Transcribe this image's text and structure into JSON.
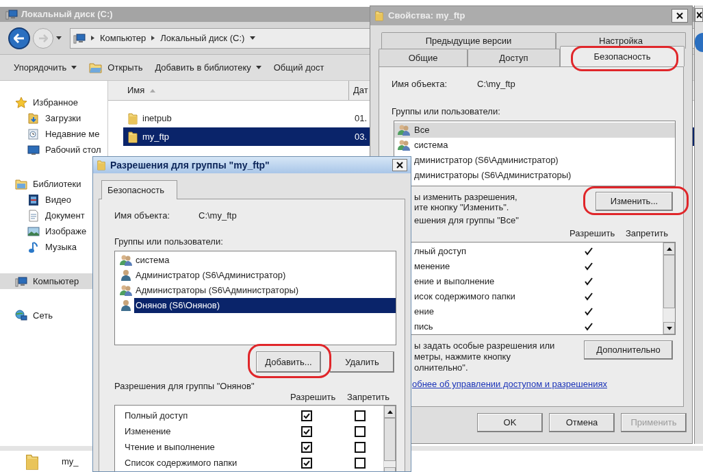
{
  "explorer": {
    "title": "Локальный диск (C:)",
    "breadcrumbs": [
      "Компьютер",
      "Локальный диск (C:)"
    ],
    "toolbar": [
      {
        "label": "Упорядочить",
        "kind": "menu"
      },
      {
        "label": "Открыть",
        "kind": "open"
      },
      {
        "label": "Добавить в библиотеку",
        "kind": "menu"
      },
      {
        "label": "Общий дост",
        "kind": "plain"
      }
    ],
    "sidebar": [
      {
        "label": "Избранное",
        "kind": "star",
        "selected": false,
        "children": [
          {
            "label": "Загрузки",
            "kind": "downloads",
            "selected": false
          },
          {
            "label": "Недавние ме",
            "kind": "recent",
            "selected": false
          },
          {
            "label": "Рабочий стол",
            "kind": "desktop",
            "selected": false
          }
        ]
      },
      {
        "label": "Библиотеки",
        "kind": "library",
        "selected": false,
        "children": [
          {
            "label": "Видео",
            "kind": "video",
            "selected": false
          },
          {
            "label": "Документ",
            "kind": "document",
            "selected": false
          },
          {
            "label": "Изображе",
            "kind": "image",
            "selected": false
          },
          {
            "label": "Музыка",
            "kind": "music",
            "selected": false
          }
        ]
      },
      {
        "label": "Компьютер",
        "kind": "computer",
        "selected": true
      },
      {
        "label": "Сеть",
        "kind": "network",
        "selected": false
      }
    ],
    "columns": [
      "Имя",
      "Дат"
    ],
    "files": [
      {
        "name": "inetpub",
        "date": "01.",
        "selected": false
      },
      {
        "name": "my_ftp",
        "date": "03.",
        "selected": true
      }
    ],
    "details": {
      "name": "my_"
    }
  },
  "properties": {
    "title": "Свойства: my_ftp",
    "tab_rows": [
      [
        {
          "label": "Предыдущие версии",
          "selected": false
        },
        {
          "label": "Настройка",
          "selected": false
        }
      ],
      [
        {
          "label": "Общие",
          "selected": false
        },
        {
          "label": "Доступ",
          "selected": false
        },
        {
          "label": "Безопасность",
          "selected": true
        }
      ]
    ],
    "object_label": "Имя объекта:",
    "object_value": "C:\\my_ftp",
    "groups_label": "Группы или пользователи:",
    "users": [
      {
        "name": "Все",
        "kind": "group",
        "selected": true
      },
      {
        "name": "система",
        "kind": "group",
        "selected": false
      },
      {
        "name": "дминистратор (S6\\Администратор)",
        "kind": "covered",
        "selected": false
      },
      {
        "name": "дминистраторы (S6\\Администраторы)",
        "kind": "covered",
        "selected": false
      }
    ],
    "edit_note": [
      "ы изменить разрешения,",
      "ите кнопку \"Изменить\"."
    ],
    "edit_button": "Изменить...",
    "permissions_label": "ешения для группы \"Все\"",
    "permission_columns": [
      "Разрешить",
      "Запретить"
    ],
    "permissions": [
      {
        "name": "лный доступ",
        "allow": true
      },
      {
        "name": "менение",
        "allow": true
      },
      {
        "name": "ение и выполнение",
        "allow": true
      },
      {
        "name": "исок содержимого папки",
        "allow": true
      },
      {
        "name": "ение",
        "allow": true
      },
      {
        "name": "пись",
        "allow": true
      }
    ],
    "advanced_note": [
      "ы задать особые разрешения или",
      "метры, нажмите кнопку",
      "олнительно\"."
    ],
    "advanced_button": "Дополнительно",
    "help_link": "обнее об управлении доступом и разрешениях",
    "buttons": [
      {
        "label": "OK",
        "disabled": false
      },
      {
        "label": "Отмена",
        "disabled": false
      },
      {
        "label": "Применить",
        "disabled": true
      }
    ]
  },
  "permissions_dialog": {
    "title": "Разрешения для группы \"my_ftp\"",
    "tab": "Безопасность",
    "object_label": "Имя объекта:",
    "object_value": "C:\\my_ftp",
    "groups_label": "Группы или пользователи:",
    "users": [
      {
        "name": "система",
        "kind": "group",
        "selected": false
      },
      {
        "name": "Администратор (S6\\Администратор)",
        "kind": "user",
        "selected": false
      },
      {
        "name": "Администраторы (S6\\Администраторы)",
        "kind": "group",
        "selected": false
      },
      {
        "name": "Онянов (S6\\Онянов)",
        "kind": "user",
        "selected": true
      }
    ],
    "add_button": "Добавить...",
    "remove_button": "Удалить",
    "permissions_label": "Разрешения для группы \"Онянов\"",
    "permission_columns": [
      "Разрешить",
      "Запретить"
    ],
    "permissions": [
      {
        "name": "Полный доступ",
        "allow": true,
        "deny": false
      },
      {
        "name": "Изменение",
        "allow": true,
        "deny": false
      },
      {
        "name": "Чтение и выполнение",
        "allow": true,
        "deny": false
      },
      {
        "name": "Список содержимого папки",
        "allow": true,
        "deny": false
      }
    ]
  }
}
